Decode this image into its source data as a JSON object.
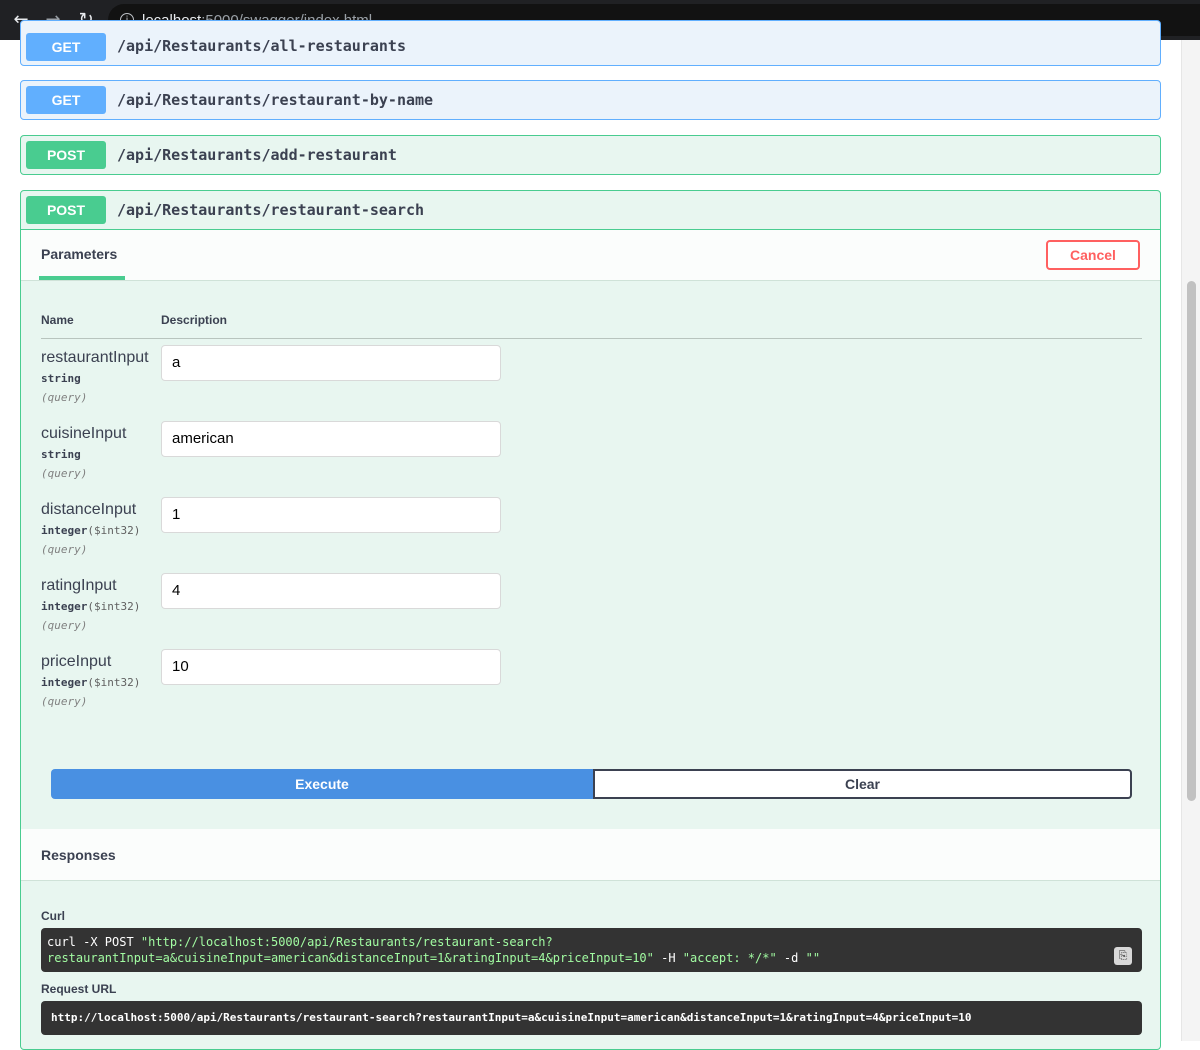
{
  "browser": {
    "host": "localhost",
    "path": ":5000/swagger/index.html"
  },
  "operations": [
    {
      "method": "GET",
      "path": "/api/Restaurants/all-restaurants"
    },
    {
      "method": "GET",
      "path": "/api/Restaurants/restaurant-by-name"
    },
    {
      "method": "POST",
      "path": "/api/Restaurants/add-restaurant"
    },
    {
      "method": "POST",
      "path": "/api/Restaurants/restaurant-search"
    }
  ],
  "panel": {
    "tab_label": "Parameters",
    "cancel_label": "Cancel",
    "col_name": "Name",
    "col_description": "Description",
    "params": [
      {
        "name": "restaurantInput",
        "type": "string",
        "format": "",
        "in": "(query)",
        "value": "a"
      },
      {
        "name": "cuisineInput",
        "type": "string",
        "format": "",
        "in": "(query)",
        "value": "american"
      },
      {
        "name": "distanceInput",
        "type": "integer",
        "format": "($int32)",
        "in": "(query)",
        "value": "1"
      },
      {
        "name": "ratingInput",
        "type": "integer",
        "format": "($int32)",
        "in": "(query)",
        "value": "4"
      },
      {
        "name": "priceInput",
        "type": "integer",
        "format": "($int32)",
        "in": "(query)",
        "value": "10"
      }
    ],
    "execute_label": "Execute",
    "clear_label": "Clear",
    "responses_title": "Responses",
    "curl_label": "Curl",
    "curl_cmd": "curl -X POST ",
    "curl_url_1": "\"http://localhost:5000/api/Restaurants/restaurant-search?",
    "curl_url_2": "restaurantInput=a&cuisineInput=american&distanceInput=1&ratingInput=4&priceInput=10\"",
    "curl_h": " -H ",
    "curl_accept": "\"accept: */*\"",
    "curl_d": " -d ",
    "curl_empty": "\"\"",
    "request_url_label": "Request URL",
    "request_url": "http://localhost:5000/api/Restaurants/restaurant-search?restaurantInput=a&cuisineInput=american&distanceInput=1&ratingInput=4&priceInput=10"
  },
  "colors": {
    "get": "#61affe",
    "post": "#49cc90",
    "execute": "#4990e2",
    "cancel": "#ff6060"
  }
}
